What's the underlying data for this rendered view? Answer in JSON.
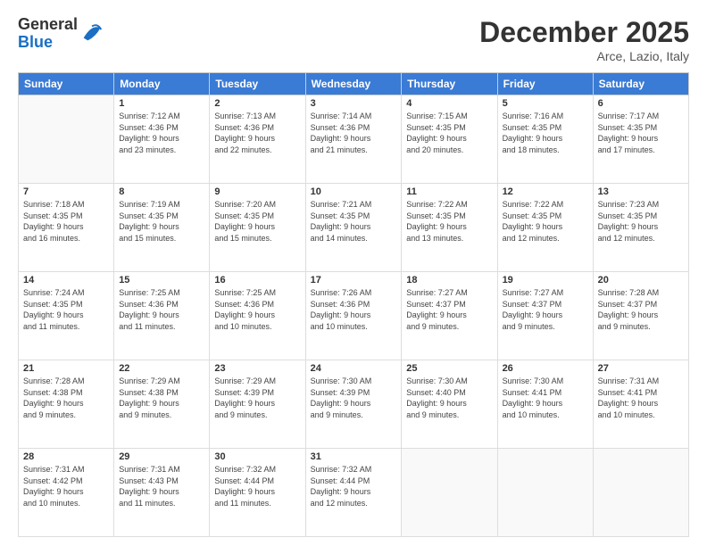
{
  "logo": {
    "general": "General",
    "blue": "Blue"
  },
  "title": "December 2025",
  "location": "Arce, Lazio, Italy",
  "days_header": [
    "Sunday",
    "Monday",
    "Tuesday",
    "Wednesday",
    "Thursday",
    "Friday",
    "Saturday"
  ],
  "weeks": [
    [
      {
        "day": "",
        "info": ""
      },
      {
        "day": "1",
        "info": "Sunrise: 7:12 AM\nSunset: 4:36 PM\nDaylight: 9 hours\nand 23 minutes."
      },
      {
        "day": "2",
        "info": "Sunrise: 7:13 AM\nSunset: 4:36 PM\nDaylight: 9 hours\nand 22 minutes."
      },
      {
        "day": "3",
        "info": "Sunrise: 7:14 AM\nSunset: 4:36 PM\nDaylight: 9 hours\nand 21 minutes."
      },
      {
        "day": "4",
        "info": "Sunrise: 7:15 AM\nSunset: 4:35 PM\nDaylight: 9 hours\nand 20 minutes."
      },
      {
        "day": "5",
        "info": "Sunrise: 7:16 AM\nSunset: 4:35 PM\nDaylight: 9 hours\nand 18 minutes."
      },
      {
        "day": "6",
        "info": "Sunrise: 7:17 AM\nSunset: 4:35 PM\nDaylight: 9 hours\nand 17 minutes."
      }
    ],
    [
      {
        "day": "7",
        "info": "Sunrise: 7:18 AM\nSunset: 4:35 PM\nDaylight: 9 hours\nand 16 minutes."
      },
      {
        "day": "8",
        "info": "Sunrise: 7:19 AM\nSunset: 4:35 PM\nDaylight: 9 hours\nand 15 minutes."
      },
      {
        "day": "9",
        "info": "Sunrise: 7:20 AM\nSunset: 4:35 PM\nDaylight: 9 hours\nand 15 minutes."
      },
      {
        "day": "10",
        "info": "Sunrise: 7:21 AM\nSunset: 4:35 PM\nDaylight: 9 hours\nand 14 minutes."
      },
      {
        "day": "11",
        "info": "Sunrise: 7:22 AM\nSunset: 4:35 PM\nDaylight: 9 hours\nand 13 minutes."
      },
      {
        "day": "12",
        "info": "Sunrise: 7:22 AM\nSunset: 4:35 PM\nDaylight: 9 hours\nand 12 minutes."
      },
      {
        "day": "13",
        "info": "Sunrise: 7:23 AM\nSunset: 4:35 PM\nDaylight: 9 hours\nand 12 minutes."
      }
    ],
    [
      {
        "day": "14",
        "info": "Sunrise: 7:24 AM\nSunset: 4:35 PM\nDaylight: 9 hours\nand 11 minutes."
      },
      {
        "day": "15",
        "info": "Sunrise: 7:25 AM\nSunset: 4:36 PM\nDaylight: 9 hours\nand 11 minutes."
      },
      {
        "day": "16",
        "info": "Sunrise: 7:25 AM\nSunset: 4:36 PM\nDaylight: 9 hours\nand 10 minutes."
      },
      {
        "day": "17",
        "info": "Sunrise: 7:26 AM\nSunset: 4:36 PM\nDaylight: 9 hours\nand 10 minutes."
      },
      {
        "day": "18",
        "info": "Sunrise: 7:27 AM\nSunset: 4:37 PM\nDaylight: 9 hours\nand 9 minutes."
      },
      {
        "day": "19",
        "info": "Sunrise: 7:27 AM\nSunset: 4:37 PM\nDaylight: 9 hours\nand 9 minutes."
      },
      {
        "day": "20",
        "info": "Sunrise: 7:28 AM\nSunset: 4:37 PM\nDaylight: 9 hours\nand 9 minutes."
      }
    ],
    [
      {
        "day": "21",
        "info": "Sunrise: 7:28 AM\nSunset: 4:38 PM\nDaylight: 9 hours\nand 9 minutes."
      },
      {
        "day": "22",
        "info": "Sunrise: 7:29 AM\nSunset: 4:38 PM\nDaylight: 9 hours\nand 9 minutes."
      },
      {
        "day": "23",
        "info": "Sunrise: 7:29 AM\nSunset: 4:39 PM\nDaylight: 9 hours\nand 9 minutes."
      },
      {
        "day": "24",
        "info": "Sunrise: 7:30 AM\nSunset: 4:39 PM\nDaylight: 9 hours\nand 9 minutes."
      },
      {
        "day": "25",
        "info": "Sunrise: 7:30 AM\nSunset: 4:40 PM\nDaylight: 9 hours\nand 9 minutes."
      },
      {
        "day": "26",
        "info": "Sunrise: 7:30 AM\nSunset: 4:41 PM\nDaylight: 9 hours\nand 10 minutes."
      },
      {
        "day": "27",
        "info": "Sunrise: 7:31 AM\nSunset: 4:41 PM\nDaylight: 9 hours\nand 10 minutes."
      }
    ],
    [
      {
        "day": "28",
        "info": "Sunrise: 7:31 AM\nSunset: 4:42 PM\nDaylight: 9 hours\nand 10 minutes."
      },
      {
        "day": "29",
        "info": "Sunrise: 7:31 AM\nSunset: 4:43 PM\nDaylight: 9 hours\nand 11 minutes."
      },
      {
        "day": "30",
        "info": "Sunrise: 7:32 AM\nSunset: 4:44 PM\nDaylight: 9 hours\nand 11 minutes."
      },
      {
        "day": "31",
        "info": "Sunrise: 7:32 AM\nSunset: 4:44 PM\nDaylight: 9 hours\nand 12 minutes."
      },
      {
        "day": "",
        "info": ""
      },
      {
        "day": "",
        "info": ""
      },
      {
        "day": "",
        "info": ""
      }
    ]
  ]
}
